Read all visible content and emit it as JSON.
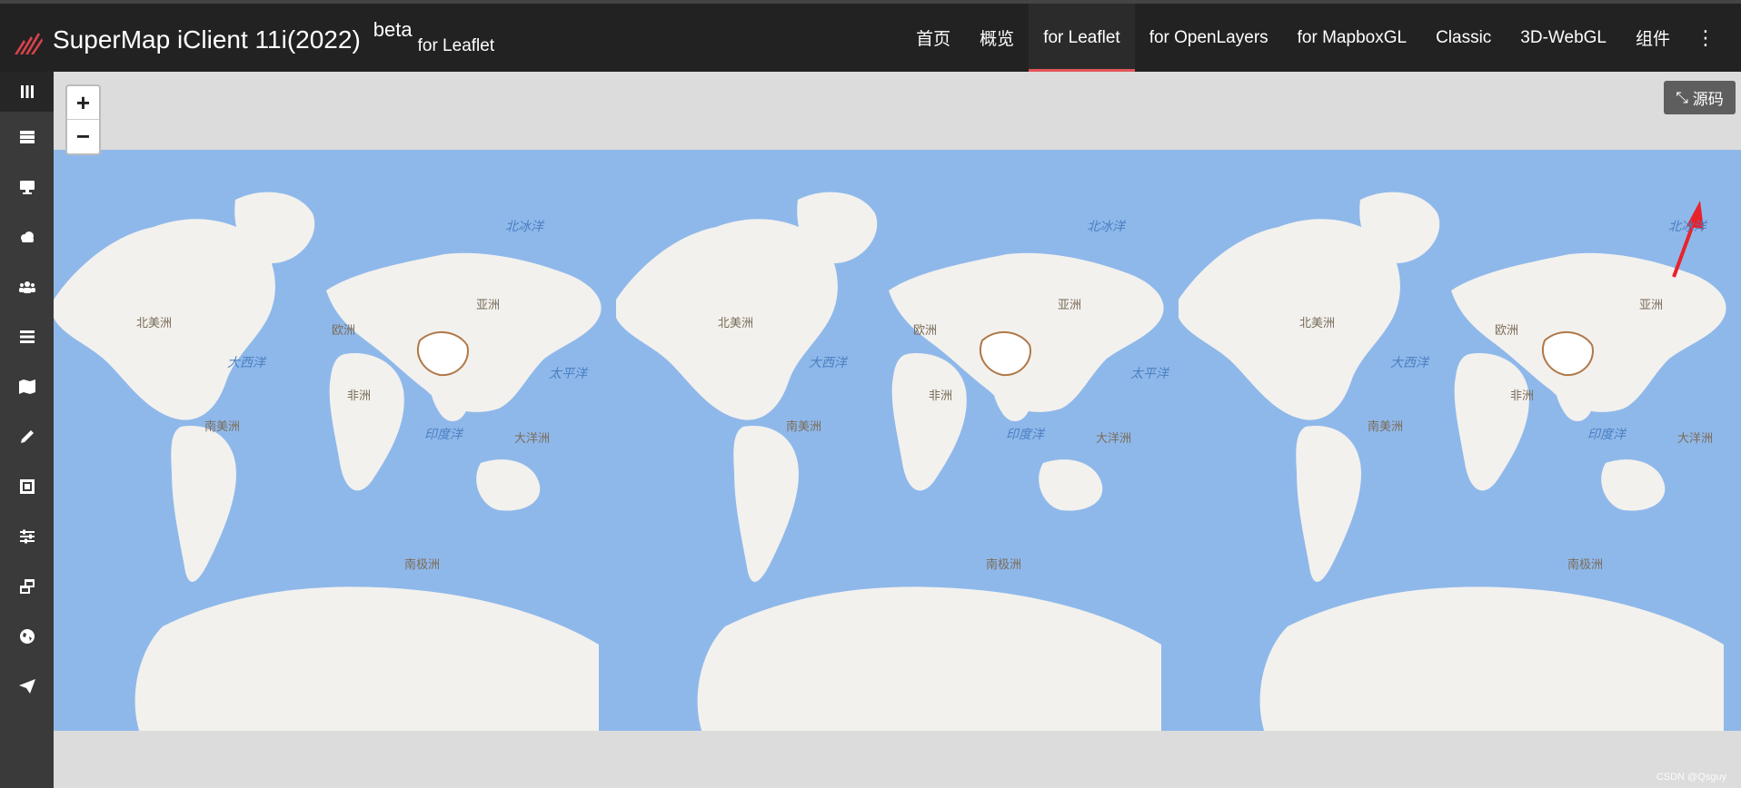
{
  "header": {
    "title": "SuperMap iClient 11i(2022)",
    "beta": "beta",
    "subtitle": "for Leaflet",
    "nav": [
      {
        "label": "首页",
        "active": false
      },
      {
        "label": "概览",
        "active": false
      },
      {
        "label": "for Leaflet",
        "active": true
      },
      {
        "label": "for OpenLayers",
        "active": false
      },
      {
        "label": "for MapboxGL",
        "active": false
      },
      {
        "label": "Classic",
        "active": false
      },
      {
        "label": "3D-WebGL",
        "active": false
      },
      {
        "label": "组件",
        "active": false
      }
    ],
    "accent": "#e2545a"
  },
  "sidebar": {
    "icons": [
      "columns-icon",
      "server-icon",
      "desktop-icon",
      "cloud-icon",
      "users-icon",
      "list-icon",
      "map-icon",
      "pencil-icon",
      "crop-icon",
      "sliders-icon",
      "windows-icon",
      "globe-icon",
      "send-icon"
    ]
  },
  "map": {
    "zoom_in": "+",
    "zoom_out": "−",
    "source_button": "源码",
    "continents": [
      "北美洲",
      "欧洲",
      "亚洲",
      "非洲",
      "南美洲",
      "大洋洲",
      "南极洲"
    ],
    "oceans": [
      "大西洋",
      "太平洋",
      "印度洋",
      "北冰洋"
    ],
    "water_color": "#8fb8ea",
    "land_color": "#f2f1ee"
  },
  "watermark": "CSDN @Qsguy"
}
